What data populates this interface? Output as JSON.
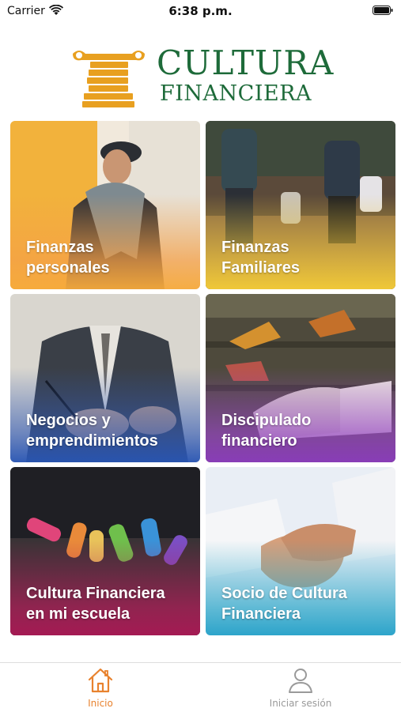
{
  "status_bar": {
    "carrier": "Carrier",
    "time": "6:38 p.m.",
    "icons": [
      "wifi-icon",
      "battery-icon"
    ]
  },
  "header": {
    "brand_line1": "CULTURA",
    "brand_line2": "FINANCIERA",
    "logo_icon": "column-coins-icon",
    "brand_color": "#1e6b3a",
    "accent_color": "#e8a020"
  },
  "tiles": [
    {
      "line1": "Finanzas",
      "line2": "personales",
      "color": "#f6aa3c"
    },
    {
      "line1": "Finanzas",
      "line2": "Familiares",
      "color": "#f5cd37"
    },
    {
      "line1": "Negocios y",
      "line2": "emprendimientos",
      "color": "#2855b4"
    },
    {
      "line1": "Discipulado",
      "line2": "financiero",
      "color": "#8c3cbe"
    },
    {
      "line1": "Cultura Financiera",
      "line2": "en mi escuela",
      "color": "#aa1955"
    },
    {
      "line1": "Socio de Cultura",
      "line2": "Financiera",
      "color": "#23a0c8"
    }
  ],
  "tab_bar": {
    "home_label": "Inicio",
    "login_label": "Iniciar sesión",
    "active_color": "#e8822e",
    "inactive_color": "#9a9a9a"
  }
}
